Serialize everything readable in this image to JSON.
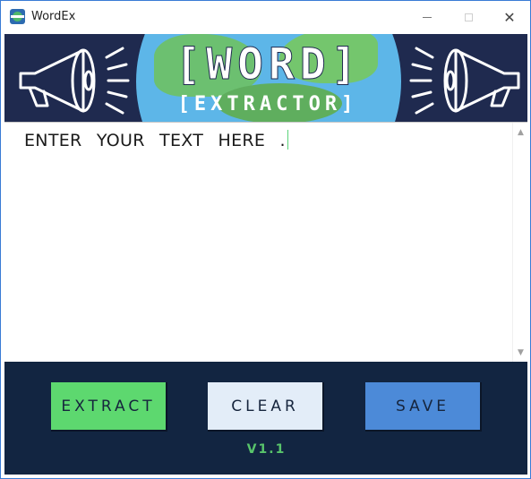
{
  "window": {
    "title": "WordEx",
    "minimize_icon": "minimize-icon",
    "maximize_icon": "maximize-icon",
    "close_icon": "close-icon",
    "close_glyph": "✕"
  },
  "banner": {
    "title": "[WORD]",
    "subtitle": "[EXTRACTOR]",
    "colors": {
      "background": "#1f2a4f",
      "ocean": "#5db6e8",
      "land": "#6cc070"
    }
  },
  "editor": {
    "text": "ENTER YOUR TEXT HERE ."
  },
  "actions": {
    "extract_label": "EXTRACT",
    "clear_label": "CLEAR",
    "save_label": "SAVE",
    "colors": {
      "extract": "#5dd86f",
      "clear": "#e3edf8",
      "save": "#4c8ad8",
      "panel": "#122541"
    }
  },
  "footer": {
    "version": "V1.1"
  }
}
